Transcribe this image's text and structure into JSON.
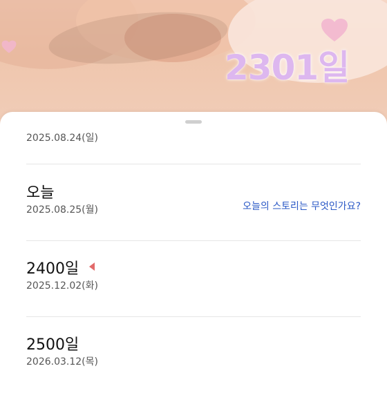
{
  "hero": {
    "dday_label": "2301일"
  },
  "timeline": {
    "items": [
      {
        "date": "2025.08.24(일)"
      },
      {
        "title": "오늘",
        "date": "2025.08.25(월)",
        "link": "오늘의 스토리는 무엇인가요?"
      },
      {
        "title": "2400일",
        "date": "2025.12.02(화)",
        "marker_icon": "triangle-marker-icon"
      },
      {
        "title": "2500일",
        "date": "2026.03.12(목)"
      }
    ]
  },
  "colors": {
    "badge_text": "#ddb7ef",
    "heart": "#f2b6cf",
    "link": "#2a58c6",
    "marker": "#e26a6a"
  }
}
